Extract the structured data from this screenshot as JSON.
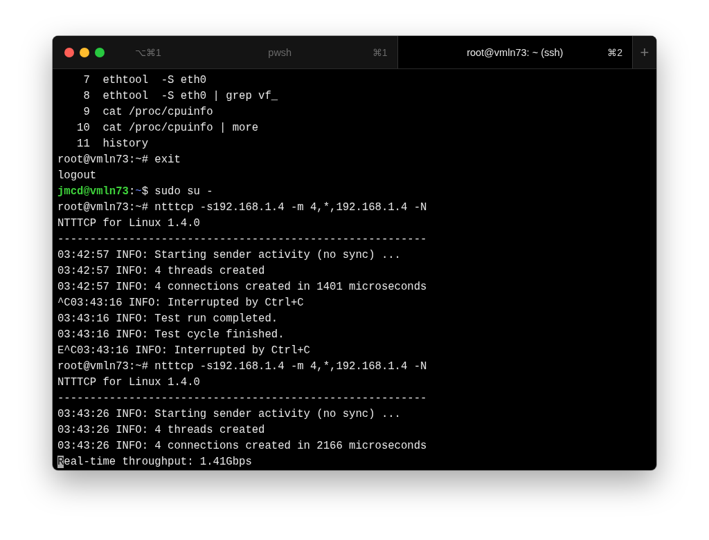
{
  "window": {
    "title_shortcut": "⌥⌘1",
    "new_tab_button": "+"
  },
  "tabs": [
    {
      "title": "pwsh",
      "shortcut": "⌘1",
      "selected": false
    },
    {
      "title": "root@vmln73: ~ (ssh)",
      "shortcut": "⌘2",
      "selected": true
    }
  ],
  "terminal": {
    "lines": [
      {
        "kind": "plain",
        "text": "    7  ethtool  -S eth0"
      },
      {
        "kind": "plain",
        "text": "    8  ethtool  -S eth0 | grep vf_"
      },
      {
        "kind": "plain",
        "text": "    9  cat /proc/cpuinfo"
      },
      {
        "kind": "plain",
        "text": "   10  cat /proc/cpuinfo | more"
      },
      {
        "kind": "plain",
        "text": "   11  history"
      },
      {
        "kind": "plain",
        "text": "root@vmln73:~# exit"
      },
      {
        "kind": "plain",
        "text": "logout"
      },
      {
        "kind": "prompt",
        "user_host": "jmcd@vmln73",
        "separator": ":",
        "path": "~",
        "command": "$ sudo su -"
      },
      {
        "kind": "plain",
        "text": "root@vmln73:~# ntttcp -s192.168.1.4 -m 4,*,192.168.1.4 -N"
      },
      {
        "kind": "plain",
        "text": "NTTTCP for Linux 1.4.0"
      },
      {
        "kind": "plain",
        "text": "---------------------------------------------------------"
      },
      {
        "kind": "plain",
        "text": "03:42:57 INFO: Starting sender activity (no sync) ..."
      },
      {
        "kind": "plain",
        "text": "03:42:57 INFO: 4 threads created"
      },
      {
        "kind": "plain",
        "text": "03:42:57 INFO: 4 connections created in 1401 microseconds"
      },
      {
        "kind": "plain",
        "text": "^C03:43:16 INFO: Interrupted by Ctrl+C"
      },
      {
        "kind": "plain",
        "text": "03:43:16 INFO: Test run completed."
      },
      {
        "kind": "plain",
        "text": "03:43:16 INFO: Test cycle finished."
      },
      {
        "kind": "plain",
        "text": "E^C03:43:16 INFO: Interrupted by Ctrl+C"
      },
      {
        "kind": "plain",
        "text": "root@vmln73:~# ntttcp -s192.168.1.4 -m 4,*,192.168.1.4 -N"
      },
      {
        "kind": "plain",
        "text": "NTTTCP for Linux 1.4.0"
      },
      {
        "kind": "plain",
        "text": "---------------------------------------------------------"
      },
      {
        "kind": "plain",
        "text": "03:43:26 INFO: Starting sender activity (no sync) ..."
      },
      {
        "kind": "plain",
        "text": "03:43:26 INFO: 4 threads created"
      },
      {
        "kind": "plain",
        "text": "03:43:26 INFO: 4 connections created in 2166 microseconds"
      },
      {
        "kind": "cursor",
        "text": "Real-time throughput: 1.41Gbps"
      }
    ]
  }
}
